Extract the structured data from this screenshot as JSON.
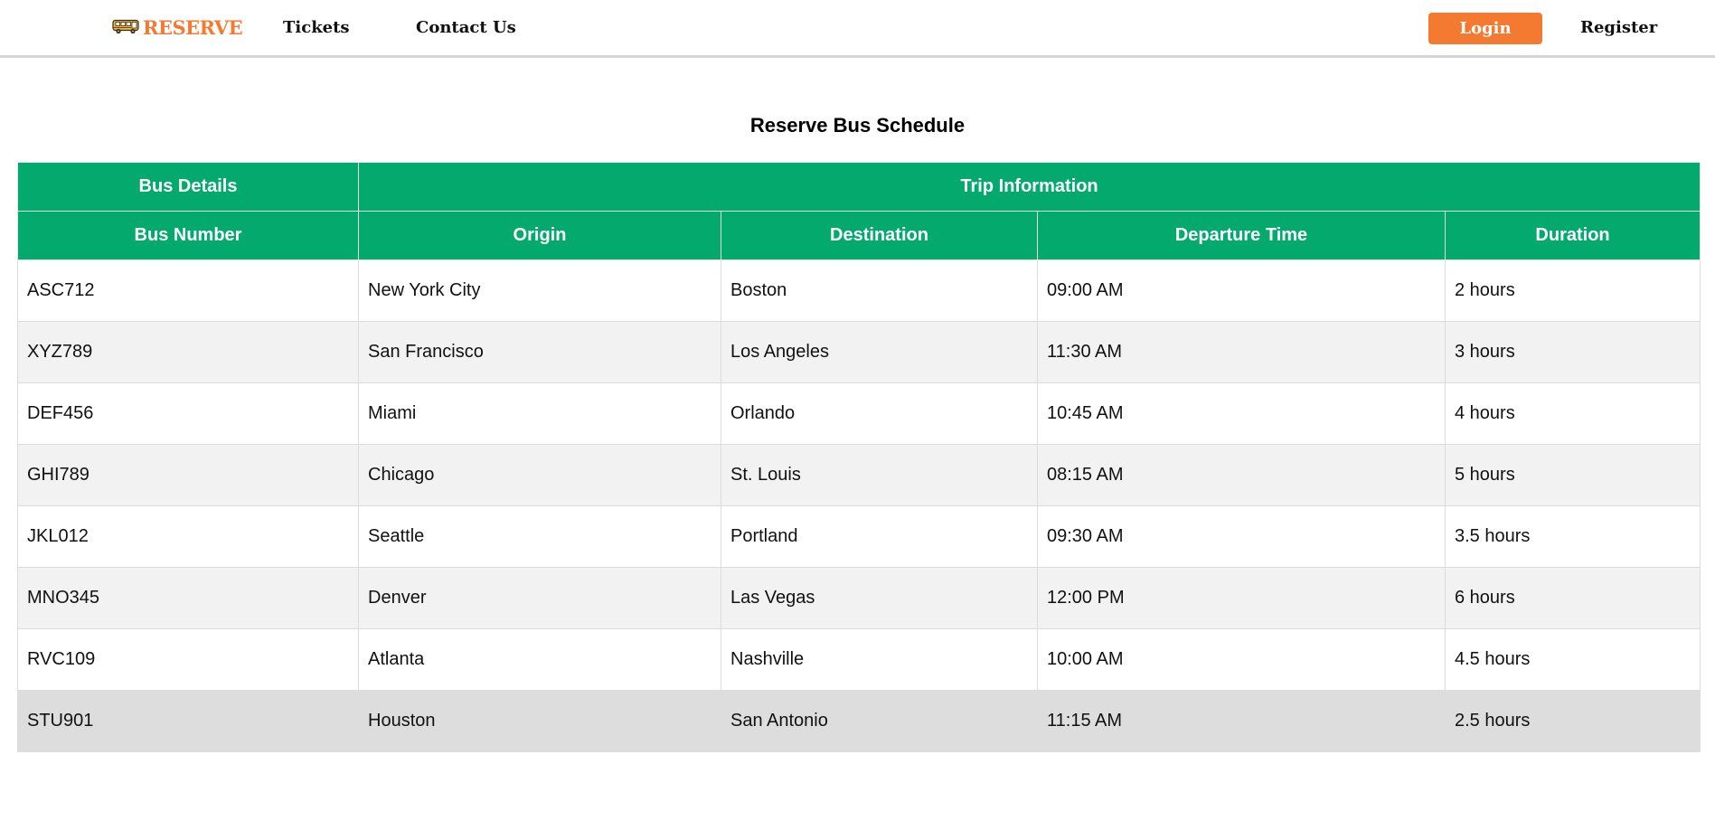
{
  "header": {
    "logo_text": "RESERVE",
    "nav": {
      "tickets": "Tickets",
      "contact": "Contact Us"
    },
    "login_label": "Login",
    "register_label": "Register"
  },
  "page": {
    "title": "Reserve Bus Schedule"
  },
  "table": {
    "group_headers": {
      "bus_details": "Bus Details",
      "trip_information": "Trip Information"
    },
    "columns": [
      "Bus Number",
      "Origin",
      "Destination",
      "Departure Time",
      "Duration"
    ],
    "rows": [
      [
        "ASC712",
        "New York City",
        "Boston",
        "09:00 AM",
        "2 hours"
      ],
      [
        "XYZ789",
        "San Francisco",
        "Los Angeles",
        "11:30 AM",
        "3 hours"
      ],
      [
        "DEF456",
        "Miami",
        "Orlando",
        "10:45 AM",
        "4 hours"
      ],
      [
        "GHI789",
        "Chicago",
        "St. Louis",
        "08:15 AM",
        "5 hours"
      ],
      [
        "JKL012",
        "Seattle",
        "Portland",
        "09:30 AM",
        "3.5 hours"
      ],
      [
        "MNO345",
        "Denver",
        "Las Vegas",
        "12:00 PM",
        "6 hours"
      ],
      [
        "RVC109",
        "Atlanta",
        "Nashville",
        "10:00 AM",
        "4.5 hours"
      ],
      [
        "STU901",
        "Houston",
        "San Antonio",
        "11:15 AM",
        "2.5 hours"
      ]
    ]
  },
  "colors": {
    "brand": "#f47a32",
    "table_header": "#04aa6d",
    "row_alt": "#f2f2f2",
    "row_hover": "#dddddd"
  },
  "icons": {
    "logo": "bus-icon"
  }
}
